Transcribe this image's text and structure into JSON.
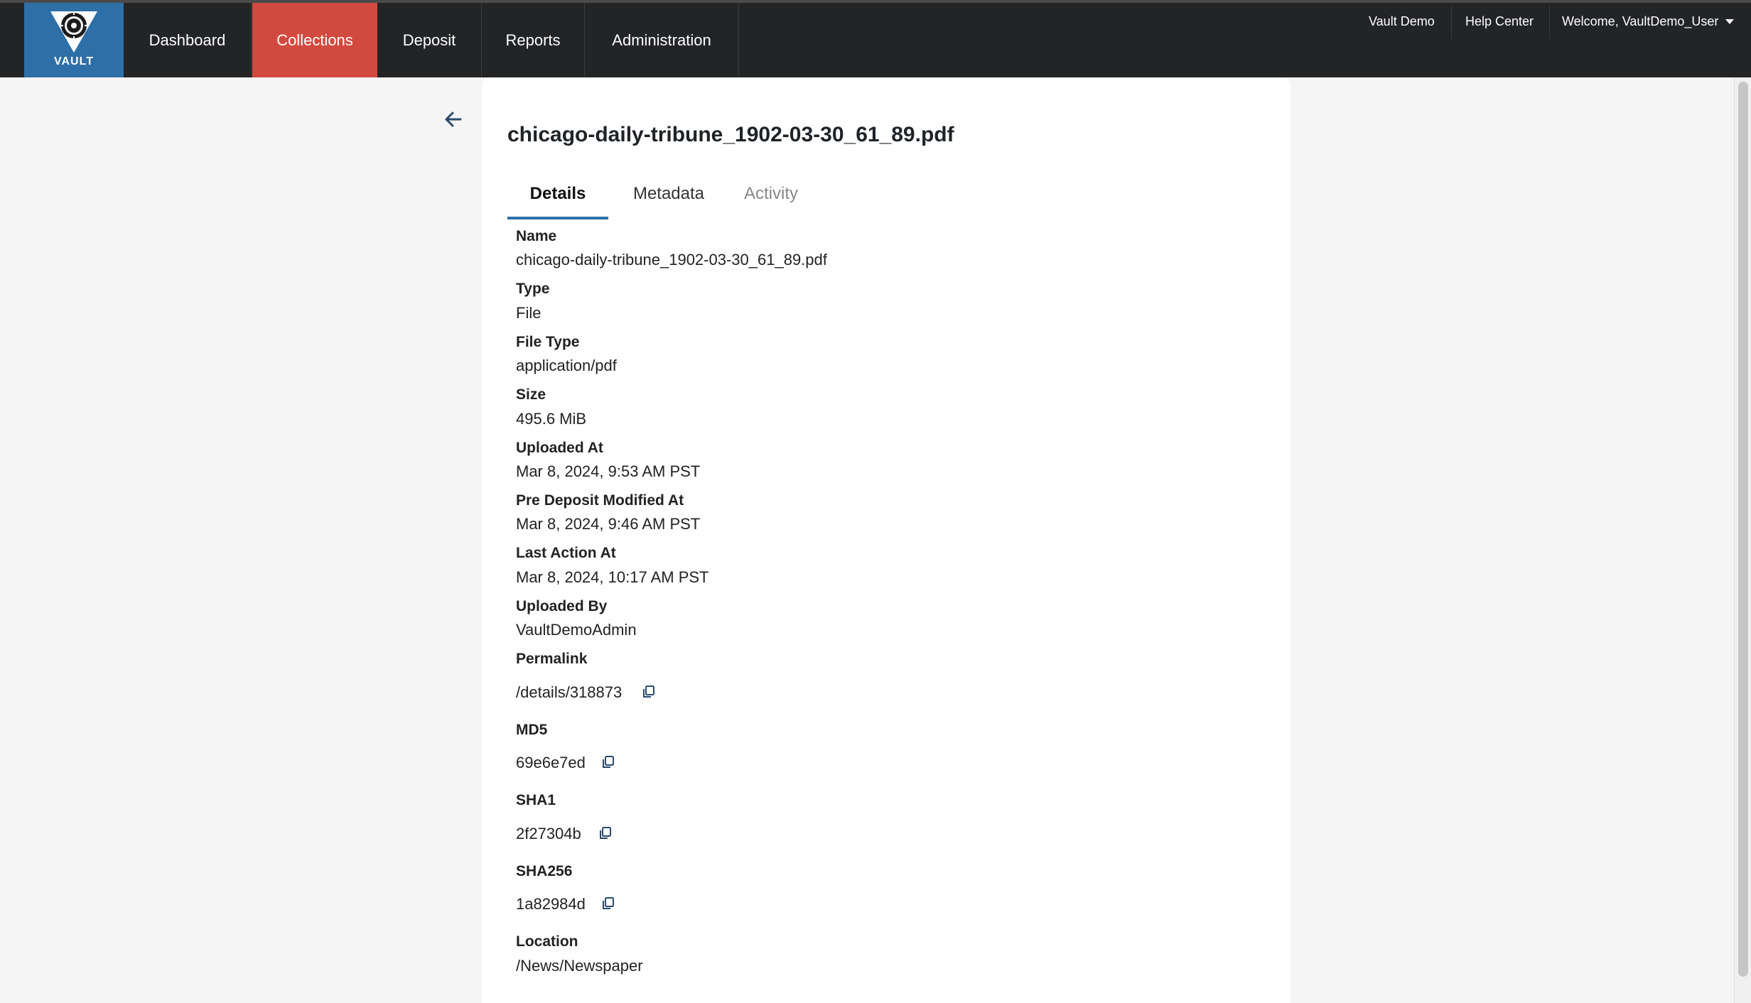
{
  "brand": {
    "logo_text": "VAULT",
    "color": "#2f6fa8"
  },
  "nav": {
    "items": [
      {
        "label": "Dashboard"
      },
      {
        "label": "Collections",
        "active": true
      },
      {
        "label": "Deposit"
      },
      {
        "label": "Reports"
      },
      {
        "label": "Administration"
      }
    ],
    "active_color": "#d24a3f"
  },
  "utility": {
    "vault_demo": "Vault Demo",
    "help_center": "Help Center",
    "welcome": "Welcome, VaultDemo_User"
  },
  "file": {
    "title": "chicago-daily-tribune_1902-03-30_61_89.pdf"
  },
  "tabs": [
    {
      "label": "Details",
      "state": "active"
    },
    {
      "label": "Metadata",
      "state": "normal"
    },
    {
      "label": "Activity",
      "state": "muted"
    }
  ],
  "details": {
    "name_label": "Name",
    "name_value": "chicago-daily-tribune_1902-03-30_61_89.pdf",
    "type_label": "Type",
    "type_value": "File",
    "filetype_label": "File Type",
    "filetype_value": "application/pdf",
    "size_label": "Size",
    "size_value": "495.6 MiB",
    "uploaded_at_label": "Uploaded At",
    "uploaded_at_value": "Mar 8, 2024, 9:53 AM PST",
    "pre_deposit_label": "Pre Deposit Modified At",
    "pre_deposit_value": "Mar 8, 2024, 9:46 AM PST",
    "last_action_label": "Last Action At",
    "last_action_value": "Mar 8, 2024, 10:17 AM PST",
    "uploaded_by_label": "Uploaded By",
    "uploaded_by_value": "VaultDemoAdmin",
    "permalink_label": "Permalink",
    "permalink_value": "/details/318873",
    "md5_label": "MD5",
    "md5_value": "69e6e7ed",
    "sha1_label": "SHA1",
    "sha1_value": "2f27304b",
    "sha256_label": "SHA256",
    "sha256_value": "1a82984d",
    "location_label": "Location",
    "location_value": "/News/Newspaper"
  },
  "icons": {
    "back": "arrow-left-icon",
    "copy": "copy-icon",
    "user_menu": "caret-down-icon"
  }
}
